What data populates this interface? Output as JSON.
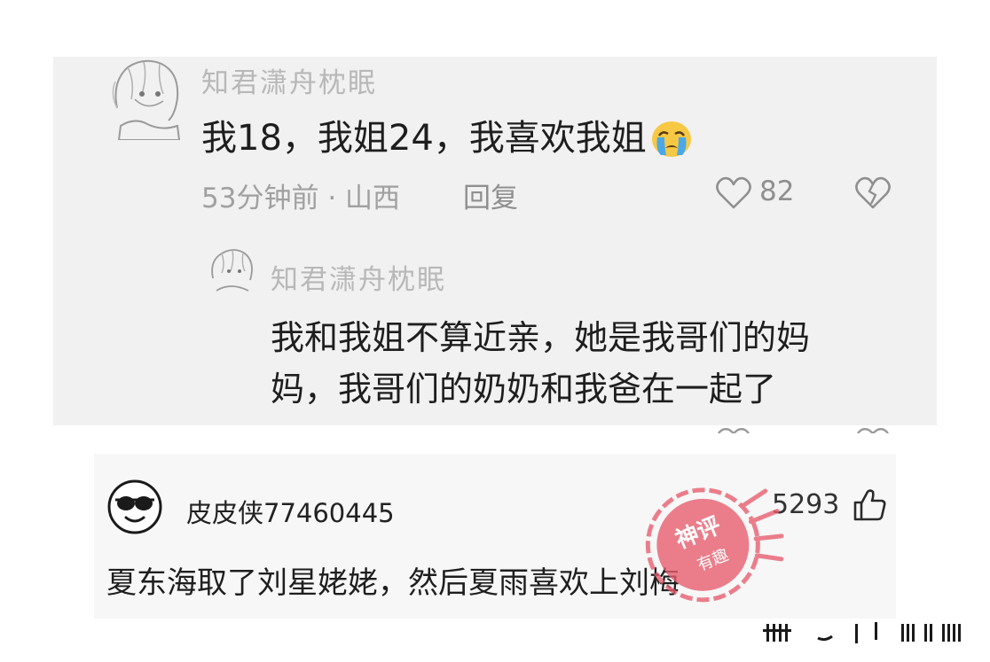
{
  "top_panel": {
    "comment": {
      "username": "知君潇舟枕眠",
      "text": "我18，我姐24，我喜欢我姐",
      "emoji": "crying-face-icon",
      "time": "53分钟前",
      "separator": "·",
      "location": "山西",
      "reply_label": "回复",
      "likes": "82"
    },
    "reply": {
      "username": "知君潇舟枕眠",
      "text": "我和我姐不算近亲，她是我哥们的妈妈，我哥们的奶奶和我爸在一起了"
    }
  },
  "bottom_panel": {
    "username": "皮皮侠77460445",
    "likes": "5293",
    "text": "夏东海取了刘星姥姥，然后夏雨喜欢上刘梅",
    "stamp": {
      "line1": "神评",
      "line2": "有趣"
    }
  },
  "colors": {
    "panel_top_bg": "#f1f1f1",
    "panel_bottom_bg": "#f7f7f7",
    "stamp_red": "#e85c6e"
  }
}
